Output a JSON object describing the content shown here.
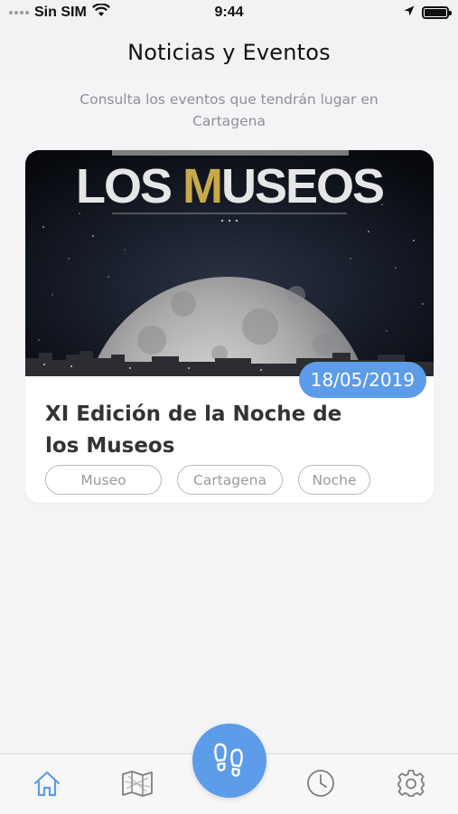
{
  "status_bar": {
    "carrier": "Sin SIM",
    "time": "9:44",
    "icons": [
      "signal-dots-icon",
      "wifi-icon",
      "location-arrow-icon",
      "battery-icon"
    ]
  },
  "header": {
    "title": "Noticias y Eventos"
  },
  "main": {
    "subtitle": "Consulta los eventos que tendrán lugar en Cartagena",
    "events": [
      {
        "poster_text": "LOS MUSEOS",
        "date": "18/05/2019",
        "title": "XI Edición de la Noche de los Museos",
        "tags": [
          "Museo",
          "Cartagena",
          "Noche"
        ]
      }
    ]
  },
  "tab_bar": {
    "items": [
      {
        "icon": "home-icon",
        "active": true
      },
      {
        "icon": "map-icon",
        "active": false
      },
      {
        "icon": "footprints-icon",
        "active": false
      },
      {
        "icon": "clock-icon",
        "active": false
      },
      {
        "icon": "gear-icon",
        "active": false
      }
    ]
  },
  "colors": {
    "accent": "#5c9ce8",
    "background": "#f4f4f6",
    "card": "#ffffff",
    "tag_border": "#b8b8bd",
    "tag_text": "#9a9aa1",
    "subtitle_text": "#8f8f96"
  }
}
